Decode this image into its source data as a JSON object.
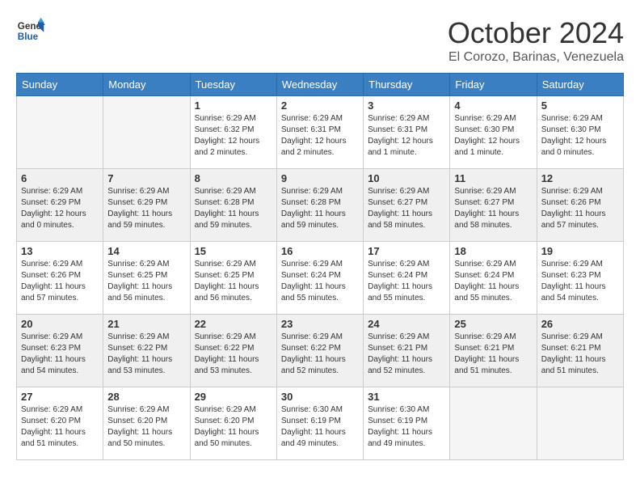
{
  "header": {
    "logo_line1": "General",
    "logo_line2": "Blue",
    "month": "October 2024",
    "location": "El Corozo, Barinas, Venezuela"
  },
  "days_of_week": [
    "Sunday",
    "Monday",
    "Tuesday",
    "Wednesday",
    "Thursday",
    "Friday",
    "Saturday"
  ],
  "weeks": [
    [
      {
        "day": "",
        "detail": ""
      },
      {
        "day": "",
        "detail": ""
      },
      {
        "day": "1",
        "detail": "Sunrise: 6:29 AM\nSunset: 6:32 PM\nDaylight: 12 hours and 2 minutes."
      },
      {
        "day": "2",
        "detail": "Sunrise: 6:29 AM\nSunset: 6:31 PM\nDaylight: 12 hours and 2 minutes."
      },
      {
        "day": "3",
        "detail": "Sunrise: 6:29 AM\nSunset: 6:31 PM\nDaylight: 12 hours and 1 minute."
      },
      {
        "day": "4",
        "detail": "Sunrise: 6:29 AM\nSunset: 6:30 PM\nDaylight: 12 hours and 1 minute."
      },
      {
        "day": "5",
        "detail": "Sunrise: 6:29 AM\nSunset: 6:30 PM\nDaylight: 12 hours and 0 minutes."
      }
    ],
    [
      {
        "day": "6",
        "detail": "Sunrise: 6:29 AM\nSunset: 6:29 PM\nDaylight: 12 hours and 0 minutes."
      },
      {
        "day": "7",
        "detail": "Sunrise: 6:29 AM\nSunset: 6:29 PM\nDaylight: 11 hours and 59 minutes."
      },
      {
        "day": "8",
        "detail": "Sunrise: 6:29 AM\nSunset: 6:28 PM\nDaylight: 11 hours and 59 minutes."
      },
      {
        "day": "9",
        "detail": "Sunrise: 6:29 AM\nSunset: 6:28 PM\nDaylight: 11 hours and 59 minutes."
      },
      {
        "day": "10",
        "detail": "Sunrise: 6:29 AM\nSunset: 6:27 PM\nDaylight: 11 hours and 58 minutes."
      },
      {
        "day": "11",
        "detail": "Sunrise: 6:29 AM\nSunset: 6:27 PM\nDaylight: 11 hours and 58 minutes."
      },
      {
        "day": "12",
        "detail": "Sunrise: 6:29 AM\nSunset: 6:26 PM\nDaylight: 11 hours and 57 minutes."
      }
    ],
    [
      {
        "day": "13",
        "detail": "Sunrise: 6:29 AM\nSunset: 6:26 PM\nDaylight: 11 hours and 57 minutes."
      },
      {
        "day": "14",
        "detail": "Sunrise: 6:29 AM\nSunset: 6:25 PM\nDaylight: 11 hours and 56 minutes."
      },
      {
        "day": "15",
        "detail": "Sunrise: 6:29 AM\nSunset: 6:25 PM\nDaylight: 11 hours and 56 minutes."
      },
      {
        "day": "16",
        "detail": "Sunrise: 6:29 AM\nSunset: 6:24 PM\nDaylight: 11 hours and 55 minutes."
      },
      {
        "day": "17",
        "detail": "Sunrise: 6:29 AM\nSunset: 6:24 PM\nDaylight: 11 hours and 55 minutes."
      },
      {
        "day": "18",
        "detail": "Sunrise: 6:29 AM\nSunset: 6:24 PM\nDaylight: 11 hours and 55 minutes."
      },
      {
        "day": "19",
        "detail": "Sunrise: 6:29 AM\nSunset: 6:23 PM\nDaylight: 11 hours and 54 minutes."
      }
    ],
    [
      {
        "day": "20",
        "detail": "Sunrise: 6:29 AM\nSunset: 6:23 PM\nDaylight: 11 hours and 54 minutes."
      },
      {
        "day": "21",
        "detail": "Sunrise: 6:29 AM\nSunset: 6:22 PM\nDaylight: 11 hours and 53 minutes."
      },
      {
        "day": "22",
        "detail": "Sunrise: 6:29 AM\nSunset: 6:22 PM\nDaylight: 11 hours and 53 minutes."
      },
      {
        "day": "23",
        "detail": "Sunrise: 6:29 AM\nSunset: 6:22 PM\nDaylight: 11 hours and 52 minutes."
      },
      {
        "day": "24",
        "detail": "Sunrise: 6:29 AM\nSunset: 6:21 PM\nDaylight: 11 hours and 52 minutes."
      },
      {
        "day": "25",
        "detail": "Sunrise: 6:29 AM\nSunset: 6:21 PM\nDaylight: 11 hours and 51 minutes."
      },
      {
        "day": "26",
        "detail": "Sunrise: 6:29 AM\nSunset: 6:21 PM\nDaylight: 11 hours and 51 minutes."
      }
    ],
    [
      {
        "day": "27",
        "detail": "Sunrise: 6:29 AM\nSunset: 6:20 PM\nDaylight: 11 hours and 51 minutes."
      },
      {
        "day": "28",
        "detail": "Sunrise: 6:29 AM\nSunset: 6:20 PM\nDaylight: 11 hours and 50 minutes."
      },
      {
        "day": "29",
        "detail": "Sunrise: 6:29 AM\nSunset: 6:20 PM\nDaylight: 11 hours and 50 minutes."
      },
      {
        "day": "30",
        "detail": "Sunrise: 6:30 AM\nSunset: 6:19 PM\nDaylight: 11 hours and 49 minutes."
      },
      {
        "day": "31",
        "detail": "Sunrise: 6:30 AM\nSunset: 6:19 PM\nDaylight: 11 hours and 49 minutes."
      },
      {
        "day": "",
        "detail": ""
      },
      {
        "day": "",
        "detail": ""
      }
    ]
  ]
}
